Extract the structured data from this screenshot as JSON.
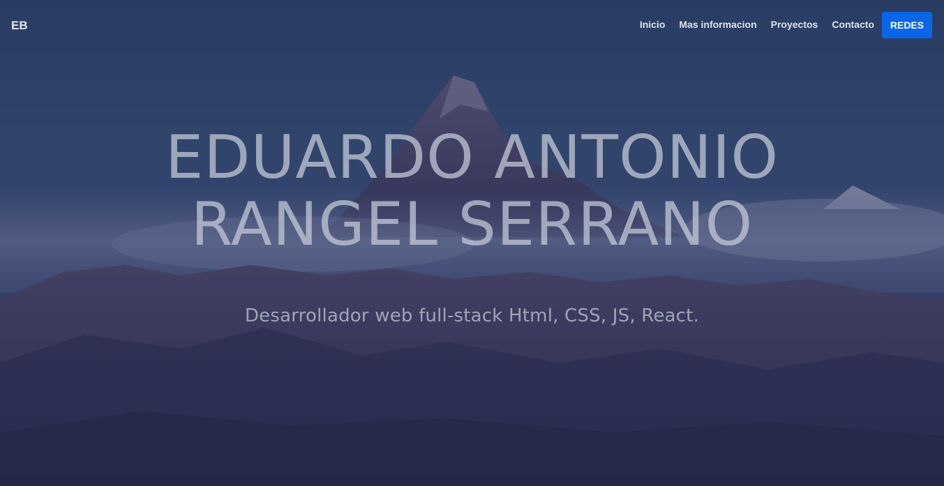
{
  "nav": {
    "brand": "EB",
    "links": [
      "Inicio",
      "Mas informacion",
      "Proyectos",
      "Contacto"
    ],
    "redes_label": "REDES"
  },
  "hero": {
    "title_line1": "EDUARDO ANTONIO",
    "title_line2": "RANGEL SERRANO",
    "subtitle": "Desarrollador web full-stack Html, CSS, JS, React."
  },
  "colors": {
    "accent": "#0a66e8",
    "background": "#364c72"
  }
}
